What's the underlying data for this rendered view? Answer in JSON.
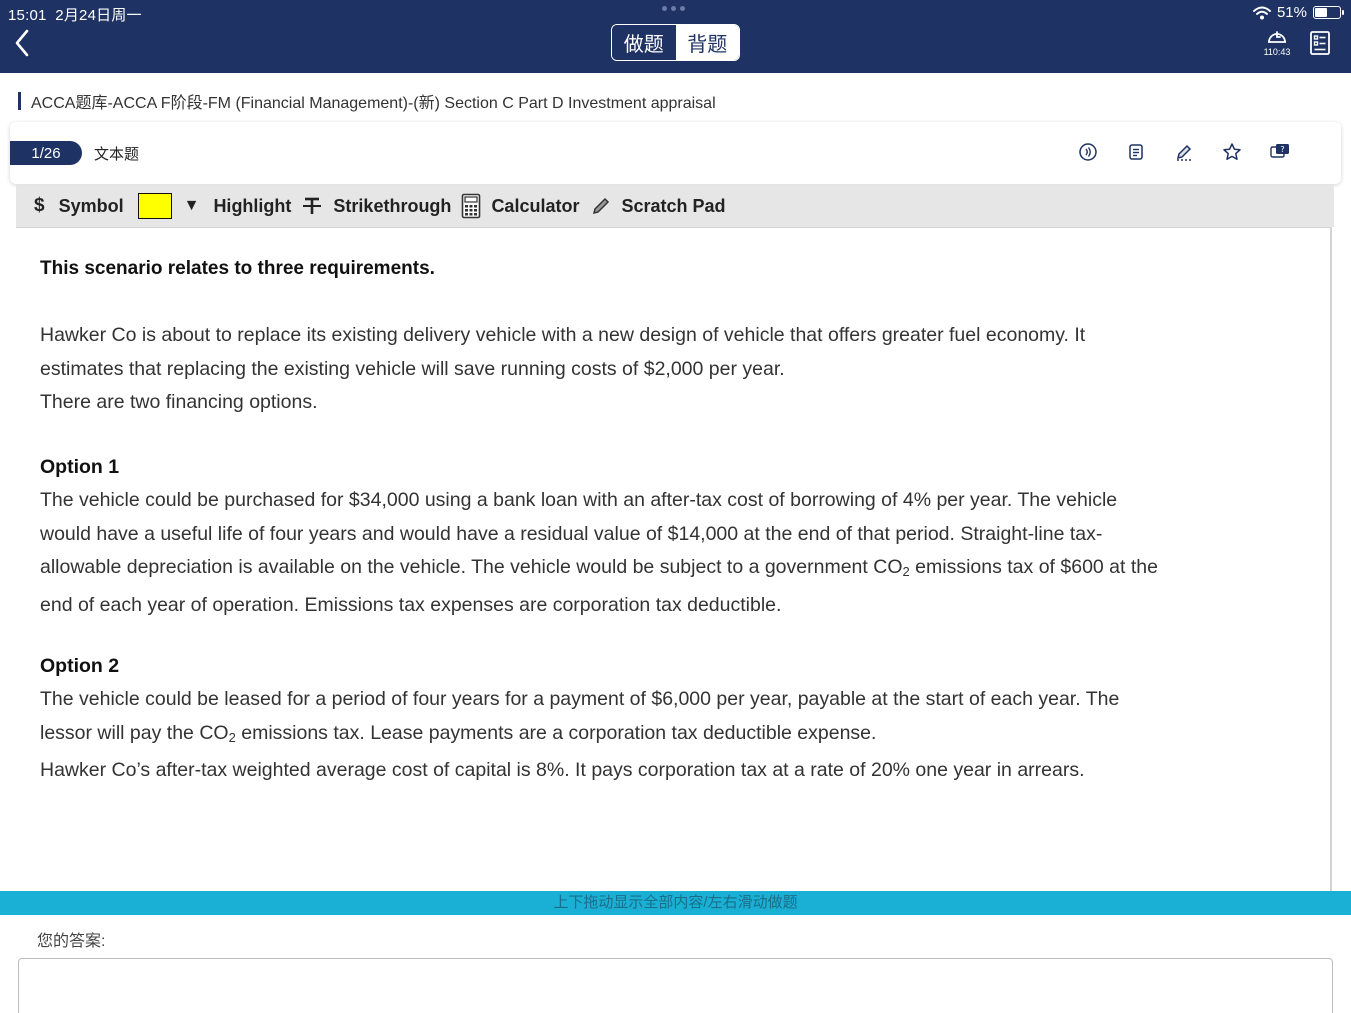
{
  "status_bar": {
    "time": "15:01",
    "date": "2月24日周一",
    "battery": "51%",
    "battery_level": 0.51
  },
  "header": {
    "tabs": [
      {
        "label": "做题",
        "active": false
      },
      {
        "label": "背题",
        "active": true
      }
    ],
    "timer": "110:43"
  },
  "breadcrumb": "ACCA题库-ACCA F阶段-FM (Financial Management)-(新) Section C  Part D Investment appraisal",
  "question": {
    "number": "1/26",
    "type": "文本题"
  },
  "exam_toolbar": {
    "symbol": "Symbol",
    "symbol_glyph": "$",
    "highlight": "Highlight",
    "highlight_color": "#ffff00",
    "strikethrough": "Strikethrough",
    "calculator": "Calculator",
    "scratch_pad": "Scratch Pad"
  },
  "scenario": {
    "intro": "This scenario relates to three requirements.",
    "para1_lines": [
      "Hawker Co is about to replace its existing delivery vehicle with a new design of vehicle that offers greater fuel economy. It",
      "estimates that replacing the existing vehicle will save running costs of $2,000 per year.",
      "There are two financing options."
    ],
    "option1_title": "Option 1",
    "option1_lines": [
      "The vehicle could be purchased for $34,000 using a bank loan with an after-tax cost of borrowing of 4% per year. The vehicle",
      "would have a useful life of four years and would have a residual value of $14,000 at the end of that period. Straight-line tax-",
      "allowable depreciation is available on the vehicle. The vehicle would be subject to a government CO",
      "end of each year of operation. Emissions tax expenses are corporation tax deductible."
    ],
    "option1_line3_sub": "2",
    "option1_line3_tail": " emissions tax of $600 at the",
    "option2_title": "Option 2",
    "option2_lines": [
      "The vehicle could be leased for a period of four years for a payment of $6,000 per year, payable at the start of each year. The",
      "lessor will pay the CO",
      "Hawker Co’s after-tax weighted average cost of capital is 8%. It pays corporation tax at a rate of 20% one year in arrears."
    ],
    "option2_line2_sub": "2",
    "option2_line2_tail": " emissions tax. Lease payments are a corporation tax deductible expense."
  },
  "drag_hint": "上下拖动显示全部内容/左右滑动做题",
  "answer": {
    "label": "您的答案:",
    "value": ""
  }
}
